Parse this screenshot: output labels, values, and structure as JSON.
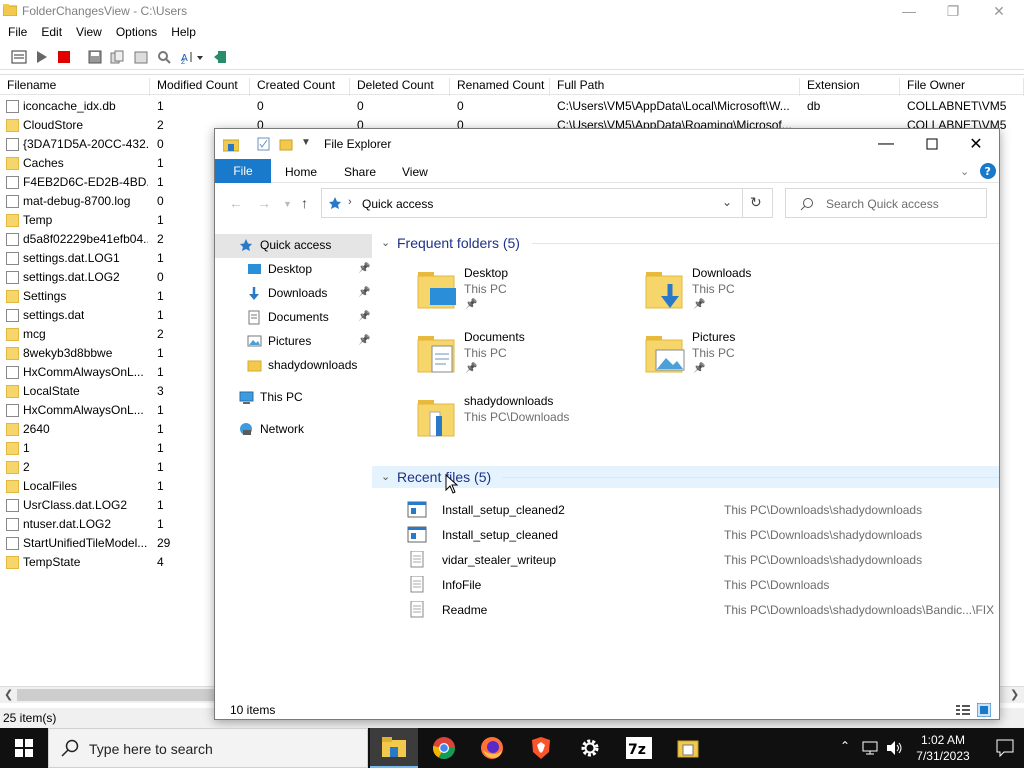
{
  "fcv": {
    "title": "FolderChangesView  -  C:\\Users",
    "menu": [
      "File",
      "Edit",
      "View",
      "Options",
      "Help"
    ],
    "columns": [
      "Filename",
      "Modified Count",
      "Created Count",
      "Deleted Count",
      "Renamed Count",
      "Full Path",
      "Extension",
      "File Owner"
    ],
    "rows": [
      {
        "name": "iconcache_idx.db",
        "type": "file",
        "modified": "1",
        "created": "0",
        "deleted": "0",
        "renamed": "0",
        "path": "C:\\Users\\VM5\\AppData\\Local\\Microsoft\\W...",
        "ext": "db",
        "owner": "COLLABNET\\VM5"
      },
      {
        "name": "CloudStore",
        "type": "folder",
        "modified": "2",
        "created": "0",
        "deleted": "0",
        "renamed": "0",
        "path": "C:\\Users\\VM5\\AppData\\Roaming\\Microsof...",
        "ext": "",
        "owner": "COLLABNET\\VM5"
      },
      {
        "name": "{3DA71D5A-20CC-432...",
        "type": "file",
        "modified": "0"
      },
      {
        "name": "Caches",
        "type": "folder",
        "modified": "1"
      },
      {
        "name": "F4EB2D6C-ED2B-4BD...",
        "type": "file",
        "modified": "1"
      },
      {
        "name": "mat-debug-8700.log",
        "type": "file",
        "modified": "0"
      },
      {
        "name": "Temp",
        "type": "folder",
        "modified": "1"
      },
      {
        "name": "d5a8f02229be41efb04...",
        "type": "file",
        "modified": "2"
      },
      {
        "name": "settings.dat.LOG1",
        "type": "file",
        "modified": "1"
      },
      {
        "name": "settings.dat.LOG2",
        "type": "file",
        "modified": "0"
      },
      {
        "name": "Settings",
        "type": "folder",
        "modified": "1"
      },
      {
        "name": "settings.dat",
        "type": "file",
        "modified": "1"
      },
      {
        "name": "mcg",
        "type": "folder",
        "modified": "2"
      },
      {
        "name": "8wekyb3d8bbwe",
        "type": "folder",
        "modified": "1"
      },
      {
        "name": "HxCommAlwaysOnL...",
        "type": "file",
        "modified": "1"
      },
      {
        "name": "LocalState",
        "type": "folder",
        "modified": "3"
      },
      {
        "name": "HxCommAlwaysOnL...",
        "type": "file",
        "modified": "1"
      },
      {
        "name": "2640",
        "type": "folder",
        "modified": "1"
      },
      {
        "name": "1",
        "type": "folder",
        "modified": "1"
      },
      {
        "name": "2",
        "type": "folder",
        "modified": "1"
      },
      {
        "name": "LocalFiles",
        "type": "folder",
        "modified": "1"
      },
      {
        "name": "UsrClass.dat.LOG2",
        "type": "file",
        "modified": "1"
      },
      {
        "name": "ntuser.dat.LOG2",
        "type": "file",
        "modified": "1"
      },
      {
        "name": "StartUnifiedTileModel...",
        "type": "file",
        "modified": "29"
      },
      {
        "name": "TempState",
        "type": "folder",
        "modified": "4"
      }
    ],
    "status": "25 item(s)"
  },
  "explorer": {
    "title": "File Explorer",
    "ribbon": {
      "file": "File",
      "tabs": [
        "Home",
        "Share",
        "View"
      ]
    },
    "address": "Quick access",
    "search_placeholder": "Search Quick access",
    "nav": [
      {
        "label": "Quick access",
        "icon": "star-icon",
        "selected": true,
        "pinned": false,
        "indent": 1
      },
      {
        "label": "Desktop",
        "icon": "desktop-icon",
        "pinned": true,
        "indent": 2
      },
      {
        "label": "Downloads",
        "icon": "download-icon",
        "pinned": true,
        "indent": 2
      },
      {
        "label": "Documents",
        "icon": "documents-icon",
        "pinned": true,
        "indent": 2
      },
      {
        "label": "Pictures",
        "icon": "pictures-icon",
        "pinned": true,
        "indent": 2
      },
      {
        "label": "shadydownloads",
        "icon": "folder-icon",
        "pinned": false,
        "indent": 2
      },
      {
        "label": "This PC",
        "icon": "computer-icon",
        "pinned": false,
        "indent": 1
      },
      {
        "label": "Network",
        "icon": "network-icon",
        "pinned": false,
        "indent": 1
      }
    ],
    "frequent_header": "Frequent folders (5)",
    "frequent": [
      {
        "name": "Desktop",
        "sub": "This PC",
        "pinned": true,
        "icon": "desktop-folder-icon"
      },
      {
        "name": "Downloads",
        "sub": "This PC",
        "pinned": true,
        "icon": "downloads-folder-icon"
      },
      {
        "name": "Documents",
        "sub": "This PC",
        "pinned": true,
        "icon": "documents-folder-icon"
      },
      {
        "name": "Pictures",
        "sub": "This PC",
        "pinned": true,
        "icon": "pictures-folder-icon"
      },
      {
        "name": "shadydownloads",
        "sub": "This PC\\Downloads",
        "pinned": false,
        "icon": "folder-icon"
      }
    ],
    "recent_header": "Recent files (5)",
    "recent": [
      {
        "name": "Install_setup_cleaned2",
        "path": "This PC\\Downloads\\shadydownloads",
        "icon": "exe-icon"
      },
      {
        "name": "Install_setup_cleaned",
        "path": "This PC\\Downloads\\shadydownloads",
        "icon": "exe-icon"
      },
      {
        "name": "vidar_stealer_writeup",
        "path": "This PC\\Downloads\\shadydownloads",
        "icon": "text-file-icon"
      },
      {
        "name": "InfoFile",
        "path": "This PC\\Downloads",
        "icon": "text-file-icon"
      },
      {
        "name": "Readme",
        "path": "This PC\\Downloads\\shadydownloads\\Bandic...\\FIX",
        "icon": "text-file-icon"
      }
    ],
    "status": "10 items"
  },
  "taskbar": {
    "search_placeholder": "Type here to search",
    "time": "1:02 AM",
    "date": "7/31/2023",
    "apps": [
      "file-explorer-icon",
      "chrome-icon",
      "firefox-icon",
      "brave-icon",
      "settings-icon",
      "7zip-icon",
      "folder-app-icon"
    ]
  },
  "colors": {
    "accent": "#1979ca",
    "taskbar": "#101010",
    "folder": "#f6d66b",
    "group_header": "#1e3287"
  }
}
